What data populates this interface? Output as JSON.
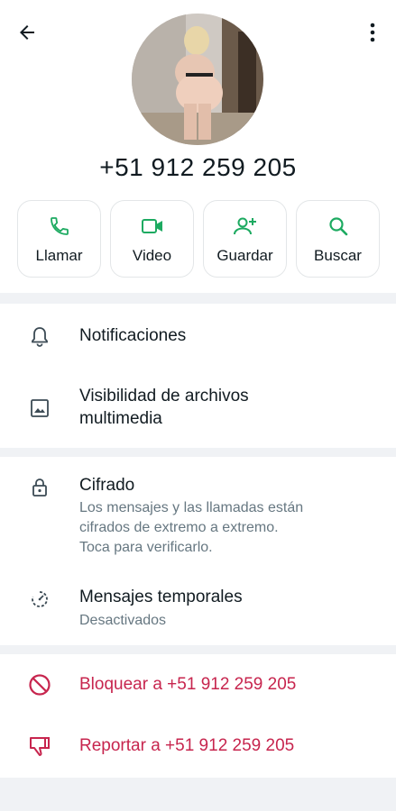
{
  "contact": {
    "phone": "+51 912 259 205"
  },
  "actions": [
    {
      "label": "Llamar",
      "icon": "phone-icon"
    },
    {
      "label": "Video",
      "icon": "video-icon"
    },
    {
      "label": "Guardar",
      "icon": "add-person-icon"
    },
    {
      "label": "Buscar",
      "icon": "search-icon"
    }
  ],
  "settings": {
    "notifications": {
      "label": "Notificaciones",
      "icon": "bell-icon"
    },
    "media_visibility": {
      "label_line1": "Visibilidad de archivos",
      "label_line2": "multimedia",
      "icon": "image-icon"
    }
  },
  "privacy": {
    "encryption": {
      "title": "Cifrado",
      "line1": "Los mensajes y las llamadas están",
      "line2": "cifrados de extremo a extremo.",
      "line3": "Toca para verificarlo.",
      "icon": "lock-icon"
    },
    "disappearing": {
      "title": "Mensajes temporales",
      "status": "Desactivados",
      "icon": "timer-icon"
    }
  },
  "danger": {
    "block_label": "Bloquear a +51 912 259 205",
    "report_label": "Reportar a +51 912 259 205",
    "block_icon": "block-icon",
    "report_icon": "thumbs-down-icon"
  },
  "colors": {
    "accent_green": "#1daa61",
    "danger_red": "#c7254e",
    "text_primary": "#111b21",
    "text_secondary": "#667781",
    "background": "#f0f2f5"
  }
}
